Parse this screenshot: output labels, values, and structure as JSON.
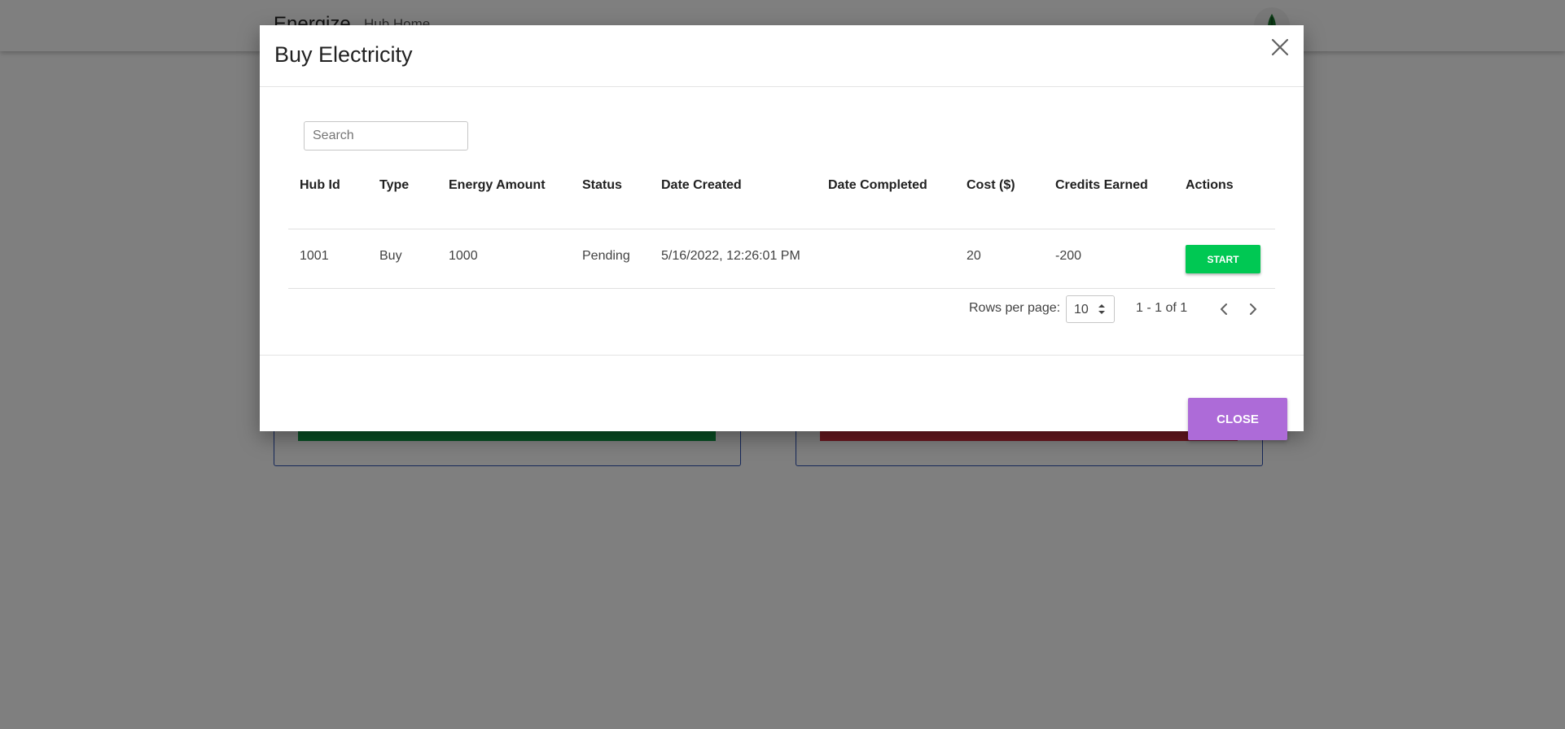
{
  "app": {
    "brand": "Energize",
    "nav_home": "Hub Home"
  },
  "modal": {
    "title": "Buy Electricity",
    "search_placeholder": "Search",
    "columns": [
      "Hub Id",
      "Type",
      "Energy Amount",
      "Status",
      "Date Created",
      "Date Completed",
      "Cost ($)",
      "Credits Earned",
      "Actions"
    ],
    "rows": [
      {
        "hub_id": "1001",
        "type": "Buy",
        "energy_amount": "1000",
        "status": "Pending",
        "date_created": "5/16/2022, 12:26:01 PM",
        "date_completed": "",
        "cost": "20",
        "credits_earned": "-200",
        "action_label": "START"
      }
    ],
    "pagination": {
      "rows_per_page_label": "Rows per page:",
      "rows_per_page_value": "10",
      "range": "1 - 1 of 1"
    },
    "close_label": "CLOSE"
  },
  "colors": {
    "start_button": "#00c853",
    "close_button": "#ad6bd8",
    "buy_card_bar": "#119c46",
    "sell_card_bar": "#d32f3f"
  },
  "icons": {
    "close": "close-icon",
    "prev": "chevron-left-icon",
    "next": "chevron-right-icon",
    "select_caret": "sort-caret-icon",
    "avatar": "leaf-avatar-icon"
  }
}
